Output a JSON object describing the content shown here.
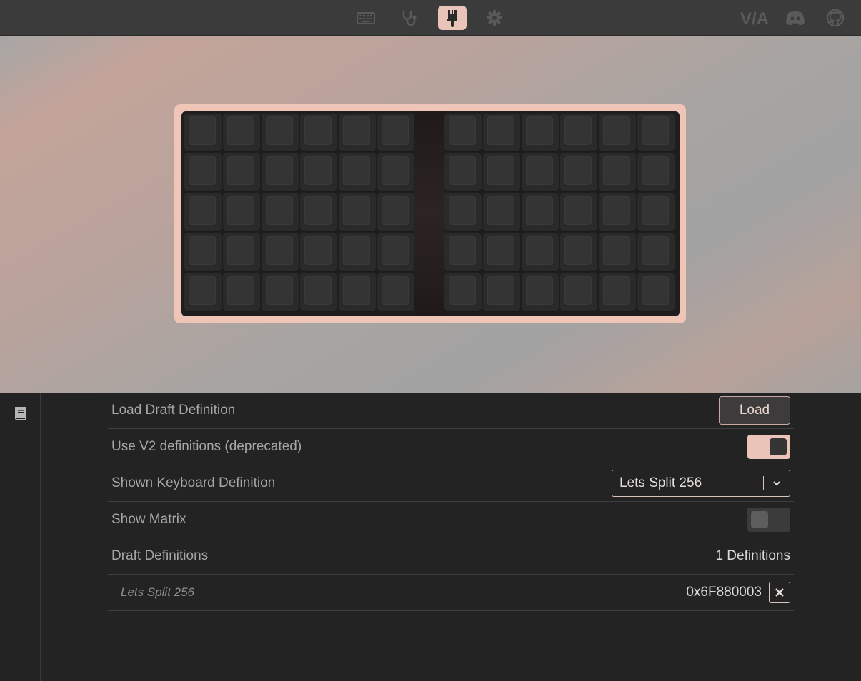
{
  "nav": {
    "icons": [
      "keyboard-icon",
      "stethoscope-icon",
      "paintbrush-icon",
      "gear-icon"
    ],
    "active": "paintbrush-icon",
    "brand": [
      "via-logo",
      "discord-icon",
      "github-icon"
    ]
  },
  "keyboard": {
    "name": "Lets Split 256",
    "rows": 5,
    "columns_per_half": 6
  },
  "settings": {
    "load_draft": {
      "label": "Load Draft Definition",
      "button": "Load"
    },
    "use_v2": {
      "label": "Use V2 definitions (deprecated)",
      "enabled": true
    },
    "shown_definition": {
      "label": "Shown Keyboard Definition",
      "selected": "Lets Split 256"
    },
    "show_matrix": {
      "label": "Show Matrix",
      "enabled": false
    },
    "draft_definitions": {
      "label": "Draft Definitions",
      "count": "1 Definitions"
    },
    "definitions": [
      {
        "name": "Lets Split 256",
        "id": "0x6F880003"
      }
    ]
  },
  "colors": {
    "accent": "#eac4b8",
    "background": "#232323",
    "topbar": "#3b3b3b"
  }
}
